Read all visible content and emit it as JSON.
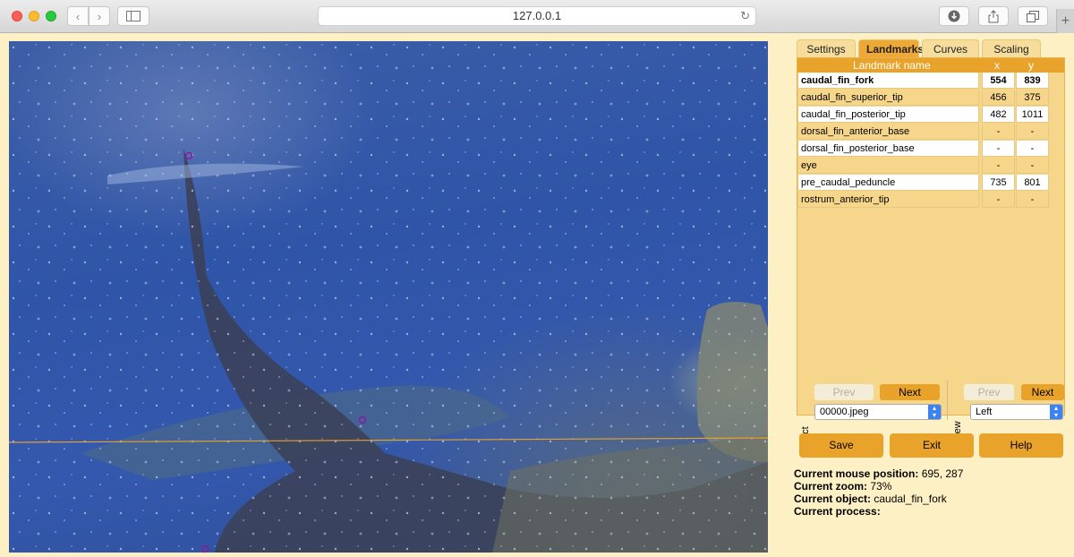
{
  "browser": {
    "url": "127.0.0.1",
    "back_glyph": "‹",
    "forward_glyph": "›",
    "reload_glyph": "↻",
    "new_tab_glyph": "+"
  },
  "tabs": [
    {
      "label": "Settings",
      "active": false
    },
    {
      "label": "Landmarks",
      "active": true
    },
    {
      "label": "Curves",
      "active": false
    },
    {
      "label": "Scaling",
      "active": false
    }
  ],
  "landmarks": {
    "headers": {
      "name": "Landmark name",
      "x": "x",
      "y": "y"
    },
    "rows": [
      {
        "name": "caudal_fin_fork",
        "x": "554",
        "y": "839"
      },
      {
        "name": "caudal_fin_superior_tip",
        "x": "456",
        "y": "375"
      },
      {
        "name": "caudal_fin_posterior_tip",
        "x": "482",
        "y": "1011"
      },
      {
        "name": "dorsal_fin_anterior_base",
        "x": "-",
        "y": "-"
      },
      {
        "name": "dorsal_fin_posterior_base",
        "x": "-",
        "y": "-"
      },
      {
        "name": "eye",
        "x": "-",
        "y": "-"
      },
      {
        "name": "pre_caudal_peduncle",
        "x": "735",
        "y": "801"
      },
      {
        "name": "rostrum_anterior_tip",
        "x": "-",
        "y": "-"
      }
    ]
  },
  "aspect": {
    "label": "Aspect",
    "prev": "Prev",
    "next": "Next",
    "selected": "00000.jpeg"
  },
  "view": {
    "label": "View",
    "prev": "Prev",
    "next": "Next",
    "selected": "Left"
  },
  "actions": {
    "save": "Save",
    "exit": "Exit",
    "help": "Help"
  },
  "status": {
    "mouse_label": "Current mouse position:",
    "mouse_value": "695, 287",
    "zoom_label": "Current zoom:",
    "zoom_value": "73%",
    "object_label": "Current object:",
    "object_value": "caudal_fin_fork",
    "process_label": "Current process:",
    "process_value": ""
  },
  "colors": {
    "accent": "#e9a32a",
    "panel_bg": "#fdf0c5",
    "landmark_marker": "#8b1aa0",
    "guide_line": "#e8a030"
  }
}
